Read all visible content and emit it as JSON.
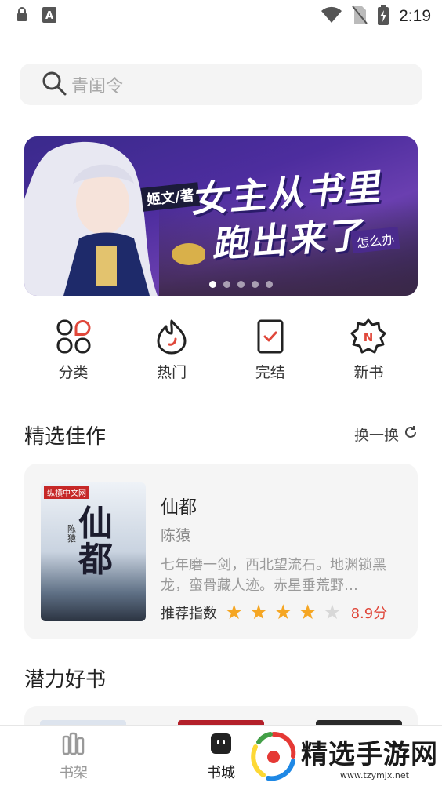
{
  "status_bar": {
    "time": "2:19",
    "icons": [
      "lock-notification-icon",
      "font-notification-icon",
      "wifi-icon",
      "no-sim-icon",
      "battery-charging-icon"
    ]
  },
  "search": {
    "placeholder": "青闺令"
  },
  "banner": {
    "author_tag": "姬文/著",
    "title_line1": "女主从书里",
    "title_line2": "跑出来了",
    "title_tag": "怎么办",
    "slide_count": 5,
    "active_slide": 1
  },
  "quick_nav": [
    {
      "label": "分类",
      "icon": "category-icon"
    },
    {
      "label": "热门",
      "icon": "flame-icon"
    },
    {
      "label": "完结",
      "icon": "completed-check-icon"
    },
    {
      "label": "新书",
      "icon": "new-badge-icon"
    }
  ],
  "featured": {
    "section_title": "精选佳作",
    "swap_label": "换一换",
    "book": {
      "title": "仙都",
      "author": "陈猿",
      "description": "七年磨一剑，西北望流石。地渊锁黑龙，蛮骨藏人迹。赤星垂荒野…",
      "rating_label": "推荐指数",
      "stars": 4,
      "max_stars": 5,
      "score": "8.9分",
      "cover_publisher": "纵横中文网",
      "cover_title": "仙都",
      "cover_author": "陈猿"
    }
  },
  "potential": {
    "section_title": "潜力好书"
  },
  "bottom_nav": {
    "items": [
      {
        "label": "书架",
        "icon": "bookshelf-icon",
        "active": false
      },
      {
        "label": "书城",
        "icon": "bookstore-icon",
        "active": true
      }
    ]
  },
  "watermark": {
    "text": "精选手游网",
    "url": "www.tzymjx.net"
  },
  "colors": {
    "accent": "#e0473a",
    "star": "#f5a623",
    "card_bg": "#f5f5f5"
  }
}
